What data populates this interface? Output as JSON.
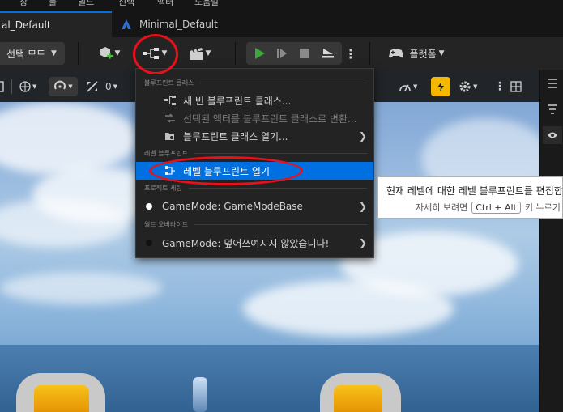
{
  "menubar": {
    "items": [
      "창",
      "툴",
      "빌드",
      "선택",
      "액터",
      "도움말"
    ]
  },
  "tabs": [
    {
      "label": "al_Default",
      "active": true
    },
    {
      "label": "Minimal_Default",
      "active": false
    }
  ],
  "toolbar": {
    "select_mode_label": "선택 모드",
    "platform_label": "플랫폼",
    "icons": [
      "add-actor-icon",
      "blueprint-icon",
      "cinematics-icon",
      "play-icon",
      "skip-icon",
      "stop-icon",
      "eject-icon",
      "more-icon",
      "gamepad-icon"
    ]
  },
  "viewport_toolbar": {
    "rotation_snap": "0",
    "icons": [
      "globe-icon",
      "snap-icon",
      "scale-icon",
      "camera-speed-icon",
      "settings-icon",
      "grid-icon"
    ]
  },
  "menu": {
    "sections": {
      "blueprint_classes": "블루프린트 클래스",
      "level_blueprint": "레벨 블루프린트",
      "project_settings": "프로젝트 세팅",
      "world_override": "월드 오버라이드"
    },
    "items": {
      "new_blueprint": "새 빈 블루프린트 클래스...",
      "convert_actors": "선택된 액터를 블루프린트 클래스로 변환...",
      "open_blueprint_class": "블루프린트 클래스 열기...",
      "open_level_blueprint": "레벨 블루프린트 열기",
      "gamemode_project": "GameMode: GameModeBase",
      "gamemode_world": "GameMode: 덮어쓰여지지 않았습니다!"
    }
  },
  "tooltip": {
    "text": "현재 레벨에 대한 레벨 블루프린트를 편집합니",
    "more_prefix": "자세히 보려면",
    "shortcut": "Ctrl + Alt",
    "more_suffix": "키 누르기"
  },
  "colors": {
    "accent_blue": "#0070e0",
    "play_green": "#3aa935",
    "annotation_red": "#e8101a",
    "highlight_gold": "#f5b800"
  }
}
